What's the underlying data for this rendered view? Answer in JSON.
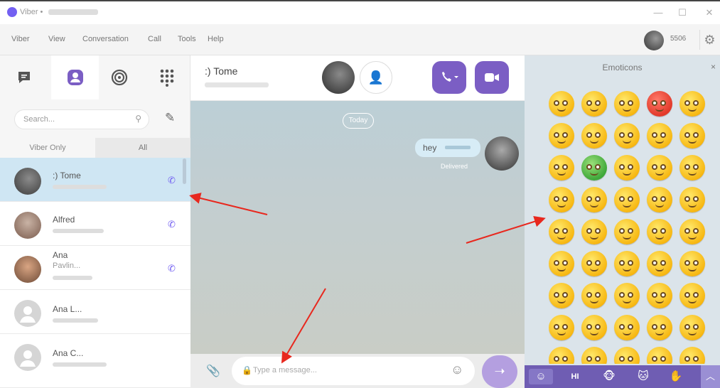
{
  "window": {
    "title": "Viber •",
    "min": "—",
    "max": "☐",
    "close": "✕"
  },
  "menu": {
    "items": [
      "Viber",
      "View",
      "Conversation",
      "Call",
      "Tools",
      "Help"
    ],
    "account": "5506"
  },
  "left": {
    "tabs": [
      "chats",
      "contacts",
      "stickers",
      "dialpad"
    ],
    "search_placeholder": "Search...",
    "filters": {
      "viber_only": "Viber Only",
      "all": "All"
    },
    "contacts": [
      {
        "name": ":) Tome",
        "selected": true
      },
      {
        "name": "Alfred",
        "selected": false
      },
      {
        "name": "Ana",
        "name2": "Pavlin...",
        "selected": false
      },
      {
        "name": "Ana L...",
        "selected": false
      },
      {
        "name": "Ana C...",
        "selected": false
      }
    ]
  },
  "chat": {
    "contact_name": ":) Tome",
    "today_label": "Today",
    "message": {
      "text": "hey",
      "status": "Delivered"
    },
    "input_placeholder": "Type a message..."
  },
  "emoticons": {
    "title": "Emoticons",
    "close": "×",
    "categories": [
      "smile",
      "hi",
      "animals",
      "cat",
      "hand"
    ],
    "hi_label": "HI"
  },
  "colors": {
    "accent": "#7360f2",
    "selected_row": "#cfe6f3",
    "panel_bar": "#6f5db3"
  }
}
